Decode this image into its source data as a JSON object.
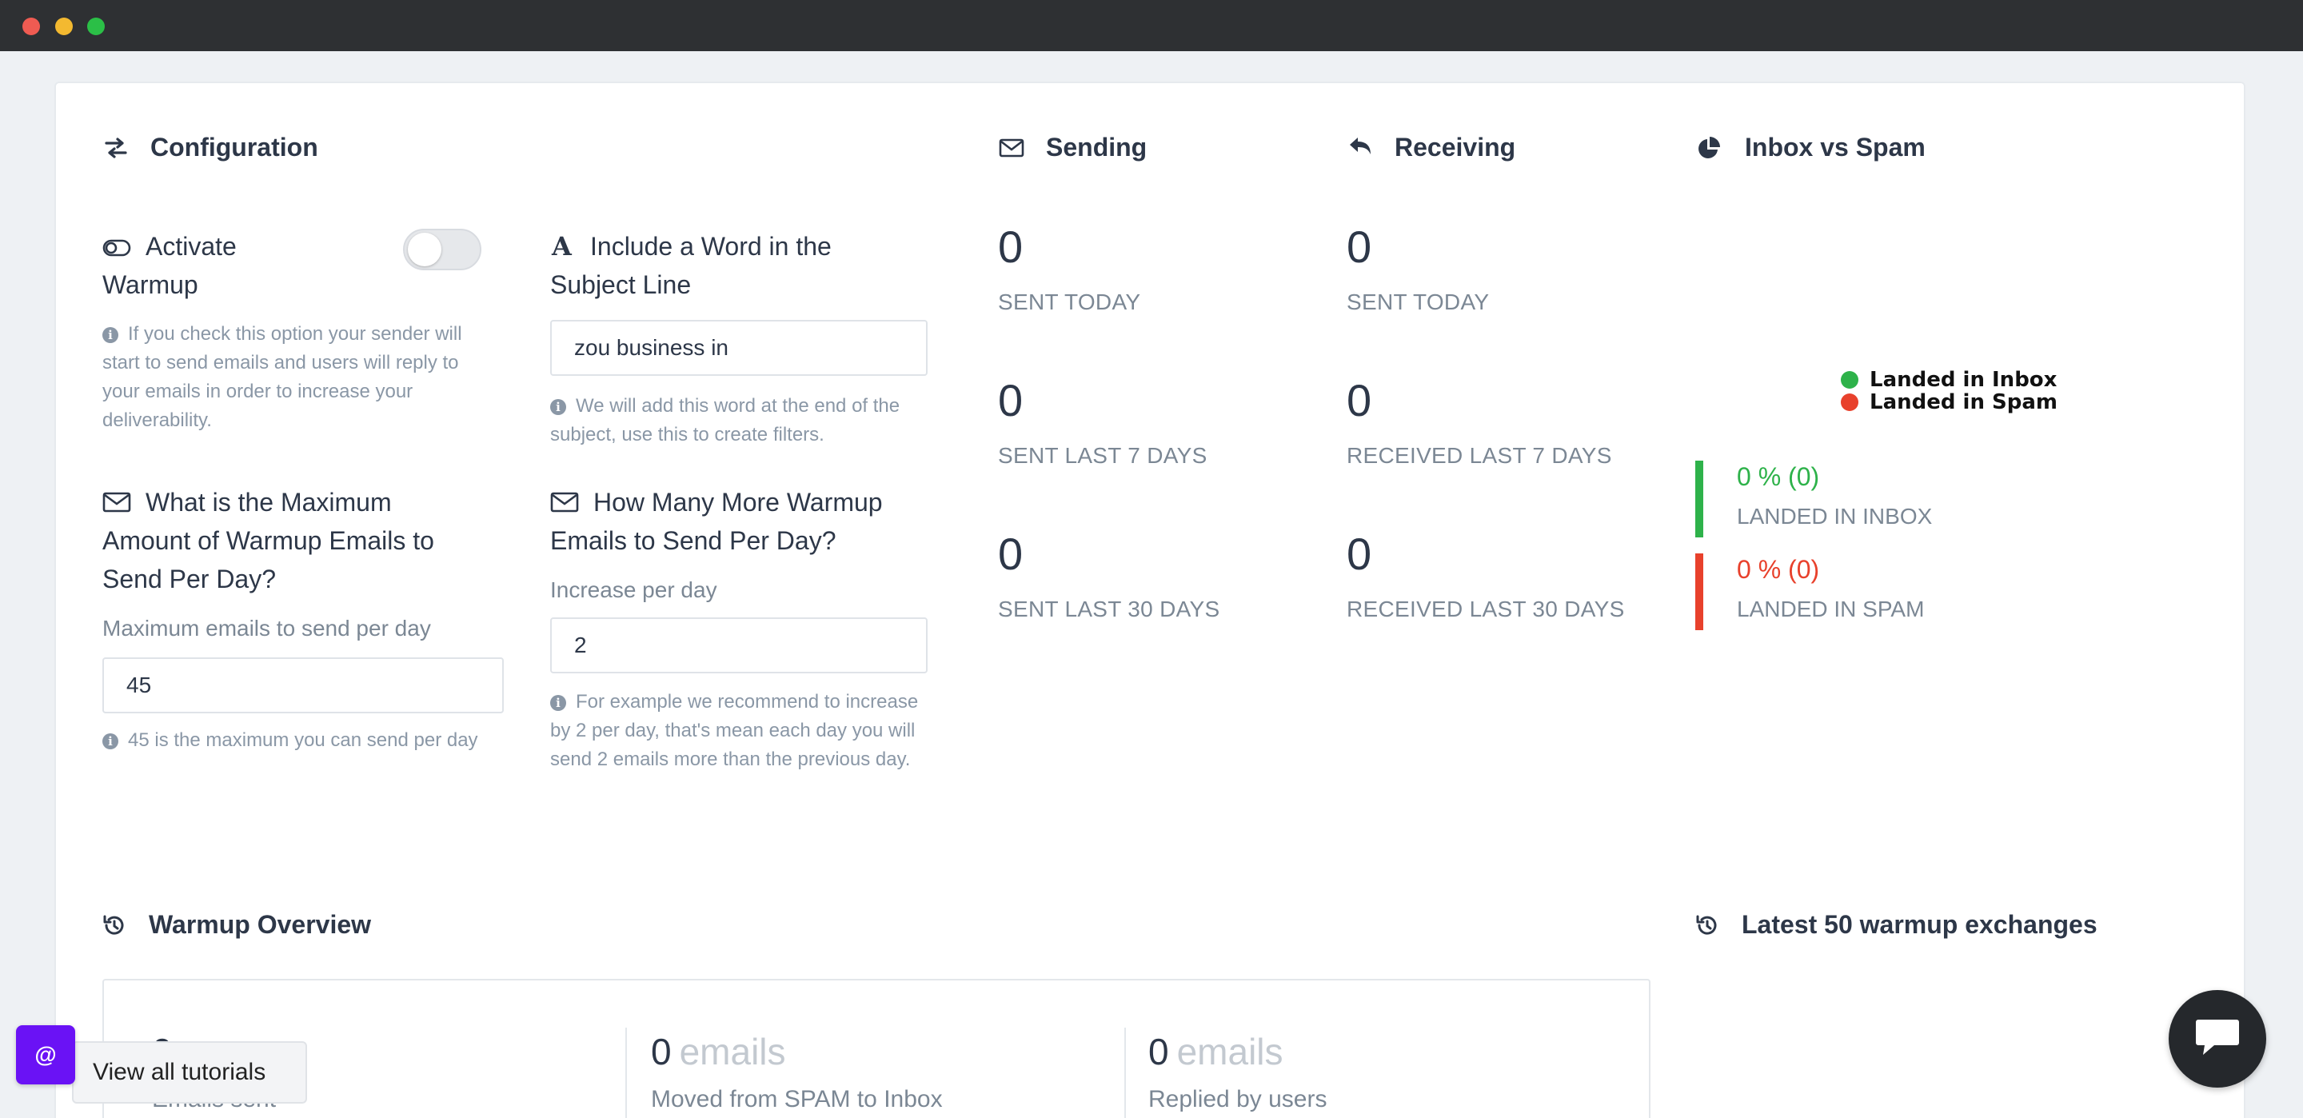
{
  "colors": {
    "accent_green": "#2eb24a",
    "accent_red": "#e8412c",
    "tutorial_purple": "#6a12f5"
  },
  "configuration": {
    "title": "Configuration",
    "activate": {
      "title_line1": "Activate",
      "title_line2": "Warmup",
      "enabled": false,
      "help": "If you check this option your sender will start to send emails and users will reply to your emails in order to increase your deliverability."
    },
    "subject_word": {
      "title_line1": "Include a Word in the",
      "title_line2": "Subject Line",
      "value": "zou business in",
      "help": "We will add this word at the end of the subject, use this to create filters."
    },
    "max_emails": {
      "title_line1": "What is the Maximum",
      "title_line2": "Amount of Warmup Emails to",
      "title_line3": "Send Per Day?",
      "label": "Maximum emails to send per day",
      "value": "45",
      "help": "45 is the maximum you can send per day"
    },
    "increase": {
      "title_line1": "How Many More Warmup",
      "title_line2": "Emails to Send Per Day?",
      "label": "Increase per day",
      "value": "2",
      "help": "For example we recommend to increase by 2 per day, that's mean each day you will send 2 emails more than the previous day."
    }
  },
  "sending": {
    "title": "Sending",
    "stats": [
      {
        "value": "0",
        "label": "SENT TODAY"
      },
      {
        "value": "0",
        "label": "SENT LAST 7 DAYS"
      },
      {
        "value": "0",
        "label": "SENT LAST 30 DAYS"
      }
    ]
  },
  "receiving": {
    "title": "Receiving",
    "stats": [
      {
        "value": "0",
        "label": "SENT TODAY"
      },
      {
        "value": "0",
        "label": "RECEIVED LAST 7 DAYS"
      },
      {
        "value": "0",
        "label": "RECEIVED LAST 30 DAYS"
      }
    ]
  },
  "inbox_vs_spam": {
    "title": "Inbox vs Spam",
    "legend": [
      "Landed in Inbox",
      "Landed in Spam"
    ],
    "inbox": {
      "percent": "0 % (0)",
      "label": "LANDED IN INBOX"
    },
    "spam": {
      "percent": "0 % (0)",
      "label": "LANDED IN SPAM"
    }
  },
  "warmup_overview": {
    "title": "Warmup Overview",
    "items": [
      {
        "value": "0",
        "unit": "",
        "label": "Emails sent"
      },
      {
        "value": "0",
        "unit": "emails",
        "label": "Moved from SPAM to Inbox"
      },
      {
        "value": "0",
        "unit": "emails",
        "label": "Replied by users"
      }
    ]
  },
  "latest_exchanges": {
    "title": "Latest 50 warmup exchanges"
  },
  "tutorials": {
    "badge": "@",
    "label": "View all tutorials"
  }
}
